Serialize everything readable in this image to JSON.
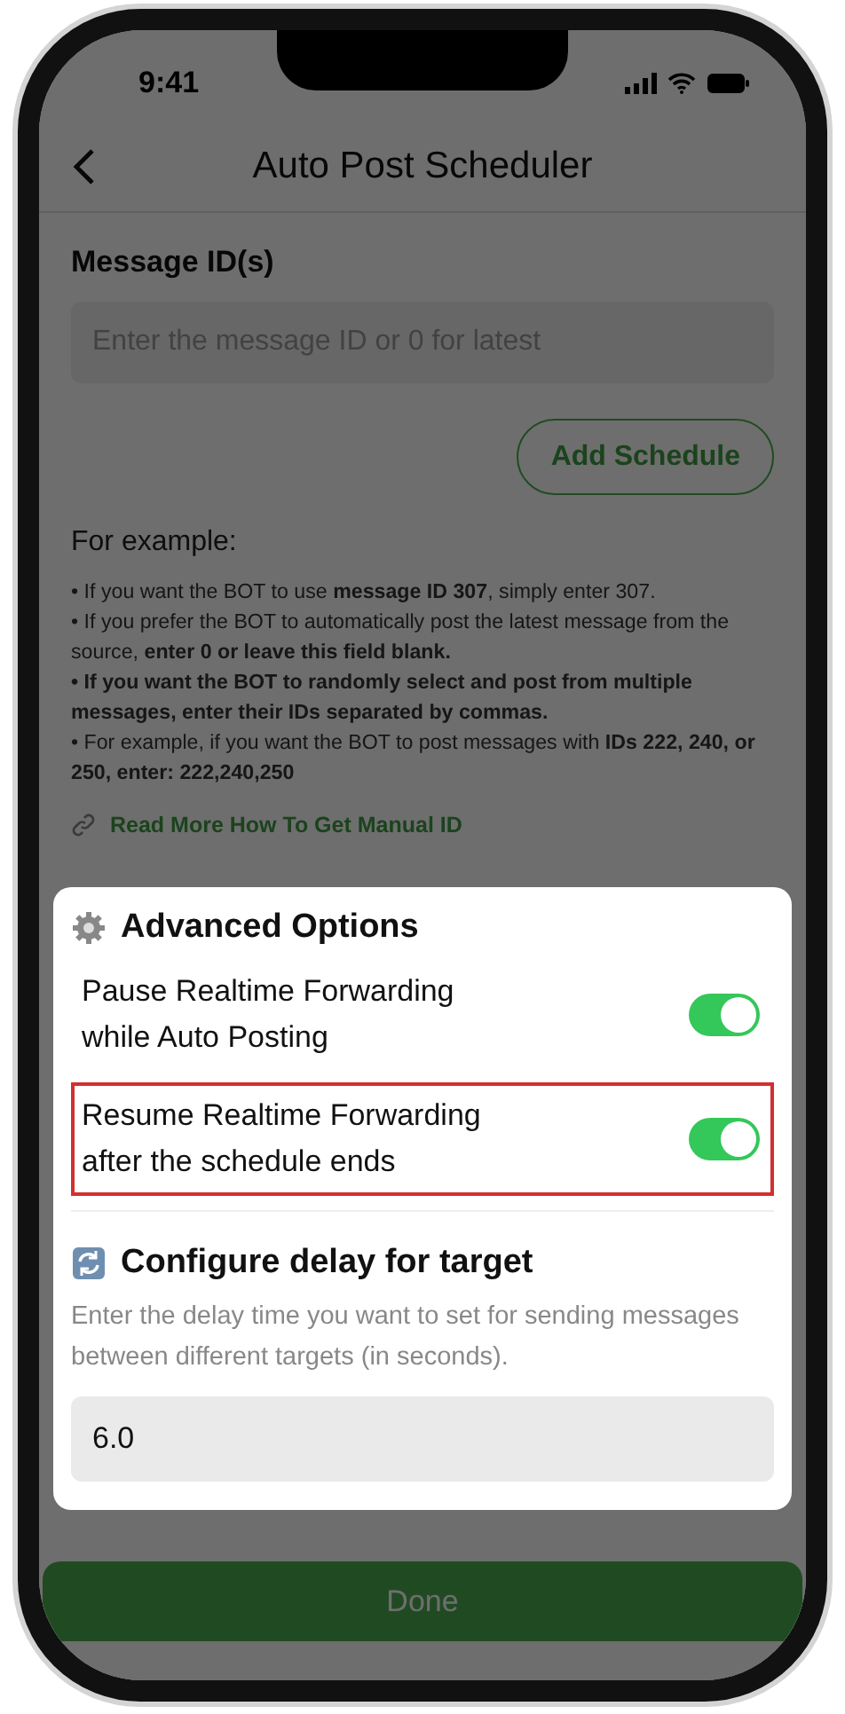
{
  "status_bar": {
    "time": "9:41"
  },
  "header": {
    "title": "Auto Post Scheduler"
  },
  "message_ids": {
    "label": "Message ID(s)",
    "placeholder": "Enter the message ID or 0 for latest"
  },
  "add_button": "Add Schedule",
  "examples": {
    "title": "For example:",
    "items": [
      {
        "text": "• If you want the BOT to use **message ID 307**, simply enter 307."
      },
      {
        "text": "• If you prefer the BOT to automatically post the latest message from the source, **enter 0 or leave this field blank.**"
      },
      {
        "text": "**• If you want the BOT to randomly select and post from multiple messages, enter their IDs separated by commas.**"
      },
      {
        "text": "• For example, if you want the BOT to post messages with **IDs 222, 240, or 250, enter: 222,240,250**"
      }
    ]
  },
  "link": "Read More How To Get Manual ID",
  "dialog": {
    "title": "Advanced Options",
    "options": [
      {
        "label": "Pause Realtime Forwarding while Auto Posting",
        "on": true,
        "highlighted": false
      },
      {
        "label": "Resume Realtime Forwarding after the schedule ends",
        "on": true,
        "highlighted": true
      }
    ],
    "delay": {
      "title": "Configure delay for target",
      "description": "Enter the delay time you want to set for sending messages between different targets (in seconds).",
      "value": "6.0"
    }
  },
  "done_button": "Done"
}
